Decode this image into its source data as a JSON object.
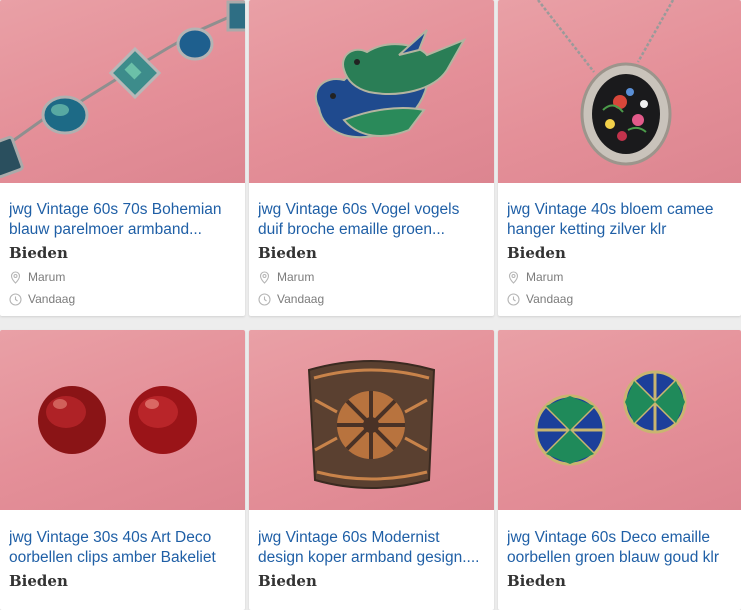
{
  "listings": [
    {
      "title": "jwg Vintage 60s 70s Bohemian blauw parelmoer armband...",
      "price": "Bieden",
      "location": "Marum",
      "date": "Vandaag",
      "image": "abalone-bracelet"
    },
    {
      "title": "jwg Vintage 60s Vogel vogels duif broche emaille groen...",
      "price": "Bieden",
      "location": "Marum",
      "date": "Vandaag",
      "image": "enamel-birds-brooch"
    },
    {
      "title": "jwg Vintage 40s bloem camee hanger ketting zilver klr",
      "price": "Bieden",
      "location": "Marum",
      "date": "Vandaag",
      "image": "floral-cameo-pendant"
    },
    {
      "title": "jwg Vintage 30s 40s Art Deco oorbellen clips amber Bakeliet",
      "price": "Bieden",
      "image": "amber-bakelite-earrings"
    },
    {
      "title": "jwg Vintage 60s Modernist design koper armband gesign....",
      "price": "Bieden",
      "image": "copper-cuff-bracelet"
    },
    {
      "title": "jwg Vintage 60s Deco emaille oorbellen groen blauw goud klr",
      "price": "Bieden",
      "image": "enamel-dome-earrings"
    }
  ],
  "icons": {
    "location": "location-pin-icon",
    "date": "clock-icon"
  },
  "colors": {
    "title": "#1f5fa6",
    "background": "#ededed",
    "photo": "#e48f98"
  }
}
